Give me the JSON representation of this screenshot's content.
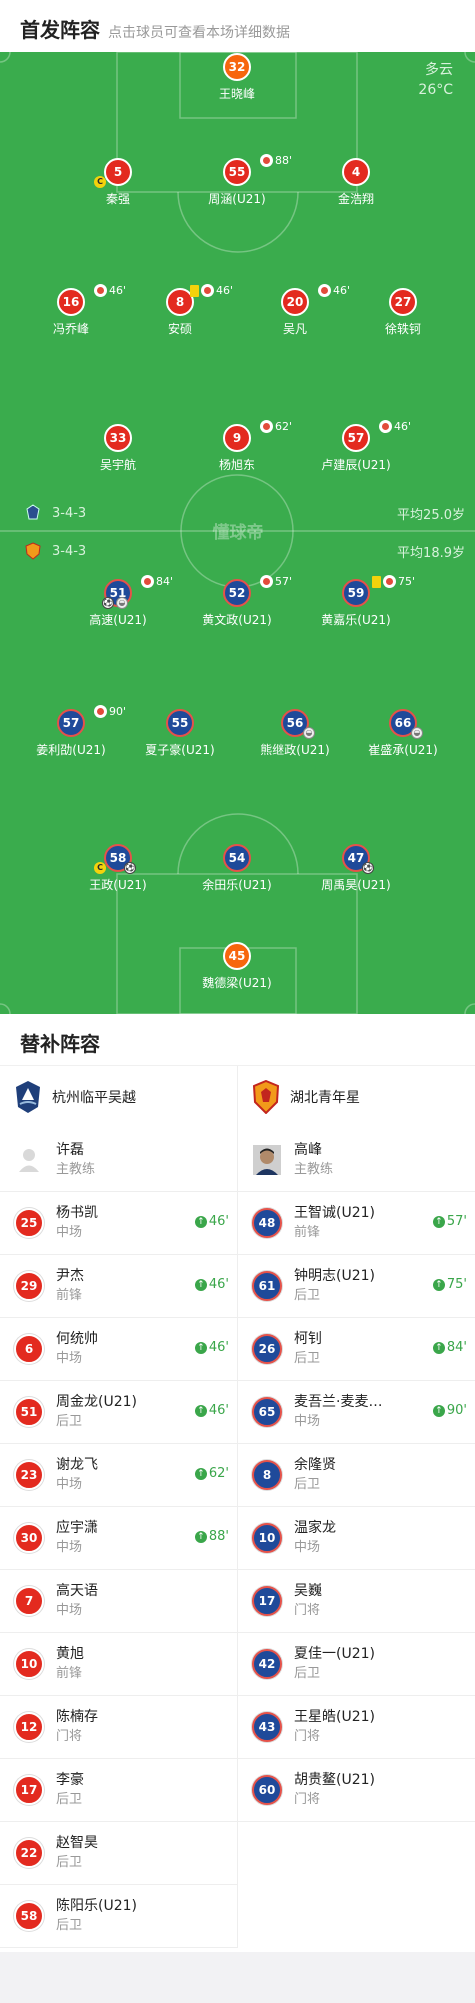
{
  "header": {
    "title": "首发阵容",
    "subtitle": "点击球员可查看本场详细数据"
  },
  "weather": {
    "condition": "多云",
    "temperature": "26°C"
  },
  "watermark": "懂球帝",
  "home_formation": {
    "formation": "3-4-3",
    "avg_age": "平均25.0岁"
  },
  "away_formation": {
    "formation": "3-4-3",
    "avg_age": "平均18.9岁"
  },
  "home_players": [
    {
      "number": "32",
      "name": "王晓峰",
      "kit": "gk",
      "sub": "",
      "card": false,
      "captain": false
    },
    {
      "number": "5",
      "name": "秦强",
      "kit": "red",
      "sub": "",
      "card": false,
      "captain": true
    },
    {
      "number": "55",
      "name": "周涵(U21)",
      "kit": "red",
      "sub": "88'",
      "card": false,
      "captain": false
    },
    {
      "number": "4",
      "name": "金浩翔",
      "kit": "red",
      "sub": "",
      "card": false,
      "captain": false
    },
    {
      "number": "16",
      "name": "冯乔峰",
      "kit": "red",
      "sub": "46'",
      "card": false,
      "captain": false
    },
    {
      "number": "8",
      "name": "安硕",
      "kit": "red",
      "sub": "46'",
      "card": true,
      "captain": false
    },
    {
      "number": "20",
      "name": "吴凡",
      "kit": "red",
      "sub": "46'",
      "card": false,
      "captain": false
    },
    {
      "number": "27",
      "name": "徐轶钶",
      "kit": "red",
      "sub": "",
      "card": false,
      "captain": false
    },
    {
      "number": "33",
      "name": "吴宇航",
      "kit": "red",
      "sub": "",
      "card": false,
      "captain": false
    },
    {
      "number": "9",
      "name": "杨旭东",
      "kit": "red",
      "sub": "62'",
      "card": false,
      "captain": false
    },
    {
      "number": "57",
      "name": "卢建辰(U21)",
      "kit": "red",
      "sub": "46'",
      "card": false,
      "captain": false
    }
  ],
  "away_players": [
    {
      "number": "51",
      "name": "高速(U21)",
      "kit": "blue",
      "sub": "84'",
      "card": false,
      "captain": false,
      "goal": true,
      "assist": true
    },
    {
      "number": "52",
      "name": "黄文政(U21)",
      "kit": "blue",
      "sub": "57'",
      "card": false,
      "captain": false,
      "goal": false,
      "assist": false
    },
    {
      "number": "59",
      "name": "黄嘉乐(U21)",
      "kit": "blue",
      "sub": "75'",
      "card": true,
      "captain": false,
      "goal": false,
      "assist": false
    },
    {
      "number": "57",
      "name": "姜利劭(U21)",
      "kit": "blue",
      "sub": "90'",
      "card": false,
      "captain": false,
      "goal": false,
      "assist": false
    },
    {
      "number": "55",
      "name": "夏子豪(U21)",
      "kit": "blue",
      "sub": "",
      "card": false,
      "captain": false,
      "goal": false,
      "assist": false
    },
    {
      "number": "56",
      "name": "熊继政(U21)",
      "kit": "blue",
      "sub": "",
      "card": false,
      "captain": false,
      "goal": false,
      "assist": true
    },
    {
      "number": "66",
      "name": "崔盛承(U21)",
      "kit": "blue",
      "sub": "",
      "card": false,
      "captain": false,
      "goal": false,
      "assist": true
    },
    {
      "number": "58",
      "name": "王政(U21)",
      "kit": "blue",
      "sub": "",
      "card": false,
      "captain": true,
      "goal": true,
      "assist": false
    },
    {
      "number": "54",
      "name": "余田乐(U21)",
      "kit": "blue",
      "sub": "",
      "card": false,
      "captain": false,
      "goal": false,
      "assist": false
    },
    {
      "number": "47",
      "name": "周禹昊(U21)",
      "kit": "blue",
      "sub": "",
      "card": false,
      "captain": false,
      "goal": true,
      "assist": false
    },
    {
      "number": "45",
      "name": "魏德梁(U21)",
      "kit": "gk",
      "sub": "",
      "card": false,
      "captain": false,
      "goal": false,
      "assist": false
    }
  ],
  "subs": {
    "title": "替补阵容",
    "home": {
      "team": "杭州临平吴越",
      "coach": {
        "name": "许磊",
        "role": "主教练"
      },
      "players": [
        {
          "number": "25",
          "name": "杨书凯",
          "pos": "中场",
          "in": "46'"
        },
        {
          "number": "29",
          "name": "尹杰",
          "pos": "前锋",
          "in": "46'"
        },
        {
          "number": "6",
          "name": "何统帅",
          "pos": "中场",
          "in": "46'"
        },
        {
          "number": "51",
          "name": "周金龙(U21)",
          "pos": "后卫",
          "in": "46'"
        },
        {
          "number": "23",
          "name": "谢龙飞",
          "pos": "中场",
          "in": "62'"
        },
        {
          "number": "30",
          "name": "应宇潇",
          "pos": "中场",
          "in": "88'"
        },
        {
          "number": "7",
          "name": "高天语",
          "pos": "中场",
          "in": ""
        },
        {
          "number": "10",
          "name": "黄旭",
          "pos": "前锋",
          "in": ""
        },
        {
          "number": "12",
          "name": "陈楠存",
          "pos": "门将",
          "in": ""
        },
        {
          "number": "17",
          "name": "李豪",
          "pos": "后卫",
          "in": ""
        },
        {
          "number": "22",
          "name": "赵智昊",
          "pos": "后卫",
          "in": ""
        },
        {
          "number": "58",
          "name": "陈阳乐(U21)",
          "pos": "后卫",
          "in": ""
        }
      ]
    },
    "away": {
      "team": "湖北青年星",
      "coach": {
        "name": "高峰",
        "role": "主教练"
      },
      "players": [
        {
          "number": "48",
          "name": "王智诚(U21)",
          "pos": "前锋",
          "in": "57'"
        },
        {
          "number": "61",
          "name": "钟明志(U21)",
          "pos": "后卫",
          "in": "75'"
        },
        {
          "number": "26",
          "name": "柯钊",
          "pos": "后卫",
          "in": "84'"
        },
        {
          "number": "65",
          "name": "麦吾兰·麦麦…",
          "pos": "中场",
          "in": "90'"
        },
        {
          "number": "8",
          "name": "余隆贤",
          "pos": "后卫",
          "in": ""
        },
        {
          "number": "10",
          "name": "温家龙",
          "pos": "中场",
          "in": ""
        },
        {
          "number": "17",
          "name": "吴巍",
          "pos": "门将",
          "in": ""
        },
        {
          "number": "42",
          "name": "夏佳一(U21)",
          "pos": "后卫",
          "in": ""
        },
        {
          "number": "43",
          "name": "王星皓(U21)",
          "pos": "门将",
          "in": ""
        },
        {
          "number": "60",
          "name": "胡贵鳌(U21)",
          "pos": "门将",
          "in": ""
        }
      ]
    }
  }
}
